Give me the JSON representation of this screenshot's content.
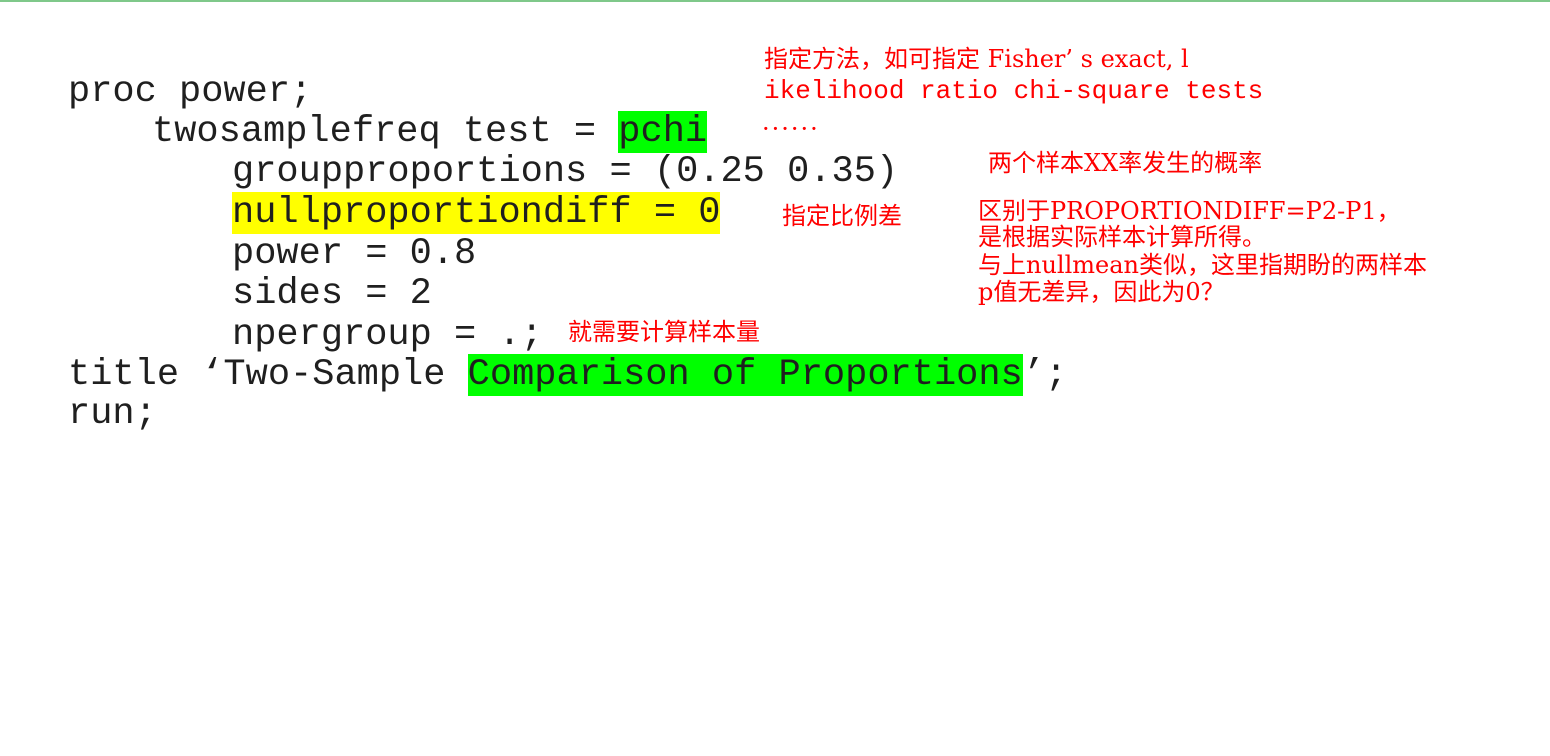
{
  "code": {
    "l1": "proc power;",
    "l2_prefix": "twosamplefreq test = ",
    "l2_hl": "pchi",
    "l3": "groupproportions = (0.25 0.35)",
    "l4_hl": "nullproportiondiff = 0",
    "l5": "power = 0.8",
    "l6": "sides = 2",
    "l7": "npergroup = .;",
    "l8_prefix": "title ‘Two-Sample ",
    "l8_hl": "Comparison of Proportions",
    "l8_suffix": "’;",
    "l9": "run;"
  },
  "notes": {
    "method_1": "指定方法，如可指定 Fisher’ s exact, l",
    "method_2": "ikelihood ratio chi-square tests",
    "dots": "······",
    "groupprop": "两个样本XX率发生的概率",
    "nulldiff": "指定比例差",
    "diff_1": "区别于PROPORTIONDIFF=P2-P1，",
    "diff_2": "是根据实际样本计算所得。",
    "diff_3": "与上nullmean类似，这里指期盼的两样本",
    "diff_4": "p值无差异，因此为0？",
    "npergroup": "就需要计算样本量"
  }
}
